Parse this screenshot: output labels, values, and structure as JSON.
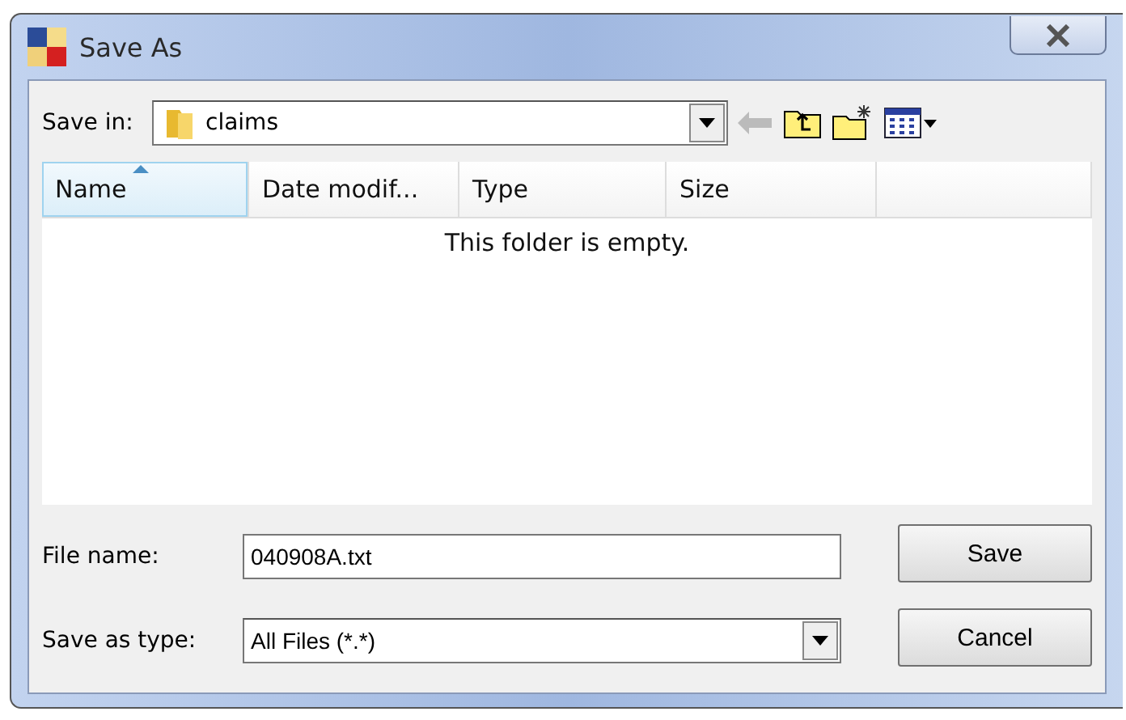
{
  "window": {
    "title": "Save As"
  },
  "save_in": {
    "label": "Save in:",
    "value": "claims"
  },
  "columns": [
    {
      "label": "Name",
      "sorted": true
    },
    {
      "label": "Date modif...",
      "sorted": false
    },
    {
      "label": "Type",
      "sorted": false
    },
    {
      "label": "Size",
      "sorted": false
    }
  ],
  "empty_message": "This folder is empty.",
  "file_name": {
    "label": "File name:",
    "value": "040908A.txt"
  },
  "save_as_type": {
    "label": "Save as type:",
    "value": "All Files (*.*)"
  },
  "buttons": [
    "Save",
    "Cancel"
  ]
}
